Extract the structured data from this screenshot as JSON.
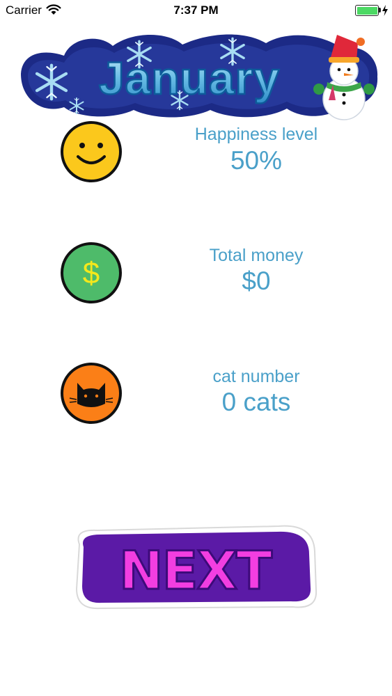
{
  "status_bar": {
    "carrier": "Carrier",
    "time": "7:37 PM",
    "battery_color": "#4cd964"
  },
  "banner": {
    "title": "January",
    "icon": "snowman-icon"
  },
  "stats": {
    "happiness": {
      "label": "Happiness level",
      "value": "50%",
      "icon": "smiley-face-icon",
      "icon_color": "#fbc81c"
    },
    "money": {
      "label": "Total money",
      "value": "$0",
      "icon": "dollar-coin-icon",
      "icon_color": "#4ebb6a"
    },
    "cats": {
      "label": "cat number",
      "value": "0 cats",
      "icon": "cat-icon",
      "icon_color": "#fb7f17"
    }
  },
  "next_button": {
    "label": "NEXT",
    "color": "#f23ee1"
  },
  "colors": {
    "stat_text": "#4aa0c9"
  }
}
